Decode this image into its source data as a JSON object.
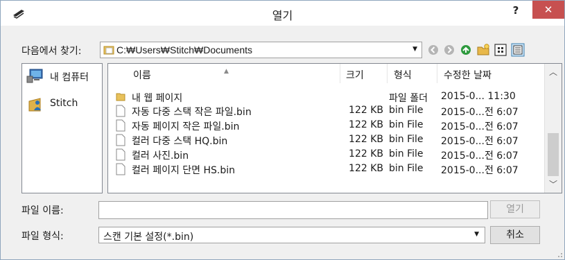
{
  "window": {
    "title": "열기",
    "help_label": "?",
    "close_label": "✕"
  },
  "lookin": {
    "label": "다음에서 찾기:",
    "path": "C:₩Users₩Stitch₩Documents"
  },
  "places": [
    {
      "label": "내 컴퓨터",
      "icon": "computer-icon"
    },
    {
      "label": "Stitch",
      "icon": "user-folder-icon"
    }
  ],
  "columns": {
    "name": "이름",
    "size": "크기",
    "type": "형식",
    "modified": "수정한 날짜"
  },
  "files": [
    {
      "name": "내 웹 페이지",
      "size": "",
      "type": "파일 폴더",
      "modified": "2015-0... 11:30",
      "icon": "folder-icon"
    },
    {
      "name": "자동 다중 스택 작은 파일.bin",
      "size": "122 KB",
      "type": "bin File",
      "modified": "2015-0...전 6:07",
      "icon": "file-icon"
    },
    {
      "name": "자동 페이지 작은 파일.bin",
      "size": "122 KB",
      "type": "bin File",
      "modified": "2015-0...전 6:07",
      "icon": "file-icon"
    },
    {
      "name": "컬러 다중 스택 HQ.bin",
      "size": "122 KB",
      "type": "bin File",
      "modified": "2015-0...전 6:07",
      "icon": "file-icon"
    },
    {
      "name": "컬러 사진.bin",
      "size": "122 KB",
      "type": "bin File",
      "modified": "2015-0...전 6:07",
      "icon": "file-icon"
    },
    {
      "name": "컬러 페이지 단면 HS.bin",
      "size": "122 KB",
      "type": "bin File",
      "modified": "2015-0...전 6:07",
      "icon": "file-icon"
    }
  ],
  "filename": {
    "label": "파일 이름:",
    "value": ""
  },
  "filetype": {
    "label": "파일 형식:",
    "value": "스캔 기본 설정(*.bin)"
  },
  "buttons": {
    "open": "열기",
    "cancel": "취소"
  },
  "colors": {
    "close_button": "#c75050",
    "accent": "#3c7fb1"
  }
}
